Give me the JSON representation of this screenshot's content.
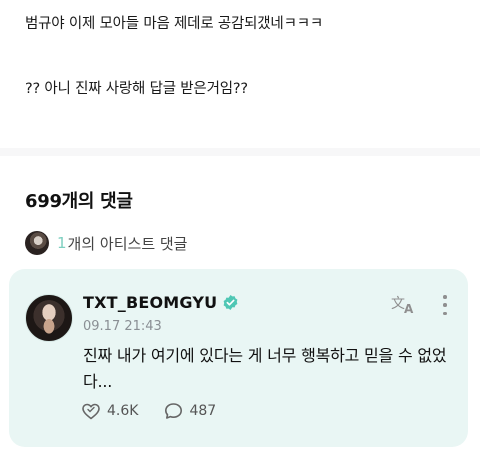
{
  "post": {
    "line1": "범규야 이제 모아들 마음 제데로 공감되갰네ㅋㅋㅋ",
    "line2": "?? 아니 진짜 사랑해 답글 받은거임??"
  },
  "comments_section": {
    "title": "699개의 댓글",
    "artist_count": "1",
    "artist_label": "개의 아티스트 댓글"
  },
  "highlighted_comment": {
    "author": "TXT_BEOMGYU",
    "verified_icon": "verified-badge-icon",
    "timestamp": "09.17 21:43",
    "body": "진짜 내가 여기에 있다는 게 너무 행복하고 믿을 수 없었다...",
    "likes": "4.6K",
    "replies": "487",
    "icons": {
      "translate": "translate-icon",
      "more": "more-vertical-icon",
      "like": "like-heart-icon",
      "reply": "reply-bubble-icon"
    }
  },
  "colors": {
    "card_background": "#e9f6f4",
    "accent": "#7ecfc0",
    "verified": "#4fc7b4"
  }
}
